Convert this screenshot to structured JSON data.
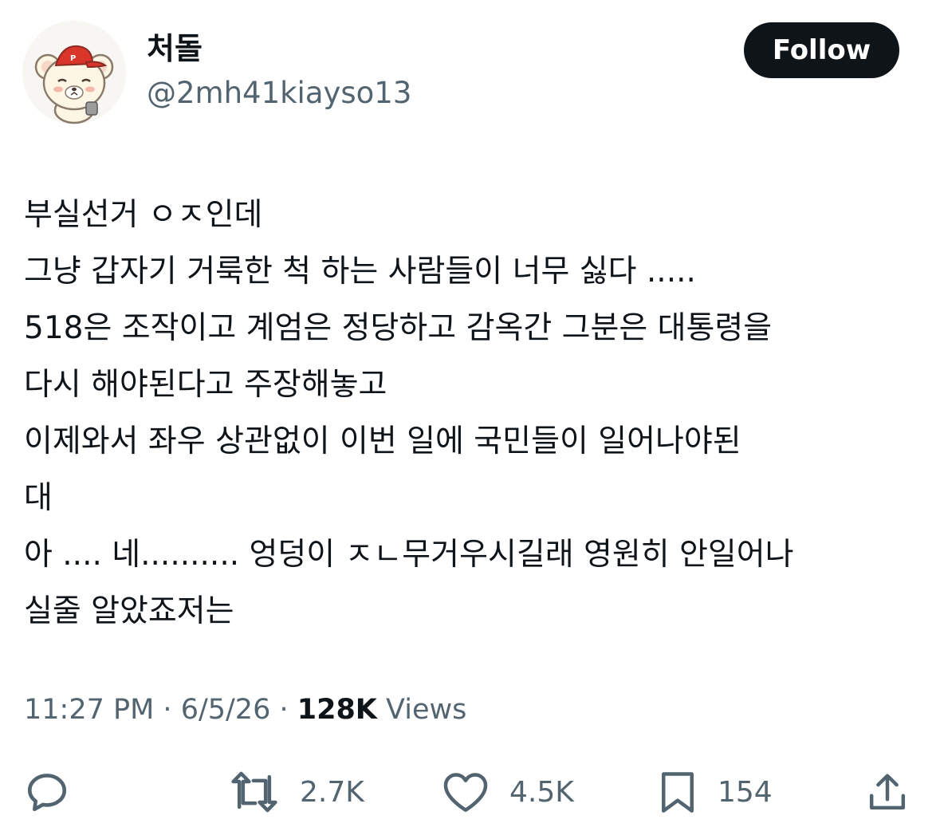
{
  "author": {
    "display_name": "처돌",
    "handle": "@2mh41kiayso13",
    "avatar_icon": "bear-with-red-cap-avatar"
  },
  "follow_button": {
    "label": "Follow"
  },
  "tweet": {
    "lines": [
      "부실선거 ㅇㅈ인데",
      "그냥 갑자기  거룩한 척 하는 사람들이 너무 싫다 .....",
      "518은 조작이고 계엄은 정당하고 감옥간 그분은 대통령을",
      "다시 해야된다고 주장해놓고",
      "이제와서 좌우 상관없이 이번 일에 국민들이 일어나야된",
      "대",
      "아 .... 네.......... 엉덩이 ㅈㄴ무거우시길래 영원히 안일어나",
      "실줄 알았죠저는"
    ]
  },
  "meta": {
    "time": "11:27 PM",
    "separator": " · ",
    "date": "6/5/26",
    "views_count": "128K",
    "views_label": " Views"
  },
  "actions": {
    "reply": {
      "icon": "reply-icon"
    },
    "retweet": {
      "icon": "retweet-icon",
      "count": "2.7K"
    },
    "like": {
      "icon": "heart-icon",
      "count": "4.5K"
    },
    "bookmark": {
      "icon": "bookmark-icon",
      "count": "154"
    },
    "share": {
      "icon": "share-icon"
    }
  },
  "colors": {
    "text_primary": "#0f1419",
    "text_secondary": "#536471",
    "follow_bg": "#0f1419",
    "avatar_cap": "#d9352b"
  }
}
